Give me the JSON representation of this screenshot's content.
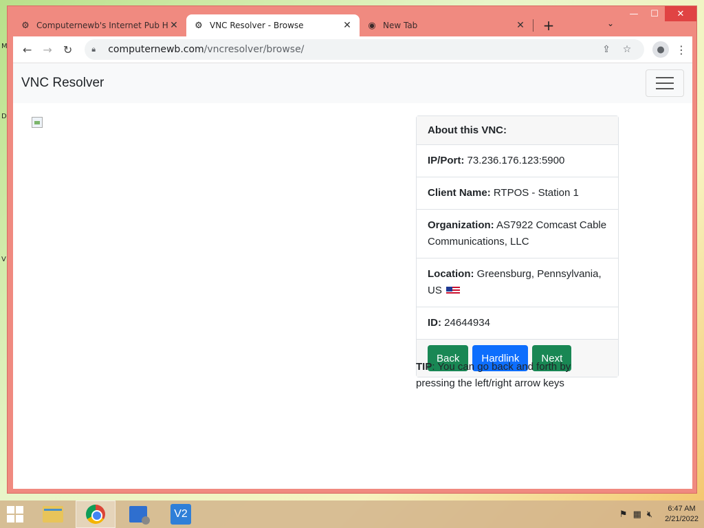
{
  "desktop": {
    "edge_glyphs": [
      "M",
      "D",
      "V"
    ]
  },
  "browser": {
    "tabs": [
      {
        "title": "Computernewb's Internet Pub H",
        "close": "✕"
      },
      {
        "title": "VNC Resolver - Browse",
        "close": "✕"
      },
      {
        "title": "New Tab",
        "close": "✕"
      }
    ],
    "new_tab": "+",
    "tab_search": "⌄",
    "window_controls": {
      "minimize": "—",
      "maximize": "☐",
      "close": "✕"
    },
    "address": {
      "host": "computernewb.com",
      "path": "/vncresolver/browse/"
    }
  },
  "page": {
    "brand": "VNC Resolver",
    "card": {
      "header": "About this VNC:",
      "ip_label": "IP/Port:",
      "ip_value": " 73.236.176.123:5900",
      "client_label": "Client Name:",
      "client_value": " RTPOS - Station 1",
      "org_label": "Organization:",
      "org_value": " AS7922 Comcast Cable Communications, LLC",
      "loc_label": "Location:",
      "loc_value": " Greensburg, Pennsylvania, US ",
      "id_label": "ID:",
      "id_value": " 24644934",
      "buttons": {
        "back": "Back",
        "hardlink": "Hardlink",
        "next": "Next"
      }
    },
    "tip_label": "TIP",
    "tip_text": ": You can go back and forth by pressing the left/right arrow keys"
  },
  "taskbar": {
    "clock_time": "6:47 AM",
    "clock_date": "2/21/2022"
  },
  "colors": {
    "button_green": "#198754",
    "button_blue": "#0d6efd",
    "window_frame": "#f08a80"
  }
}
